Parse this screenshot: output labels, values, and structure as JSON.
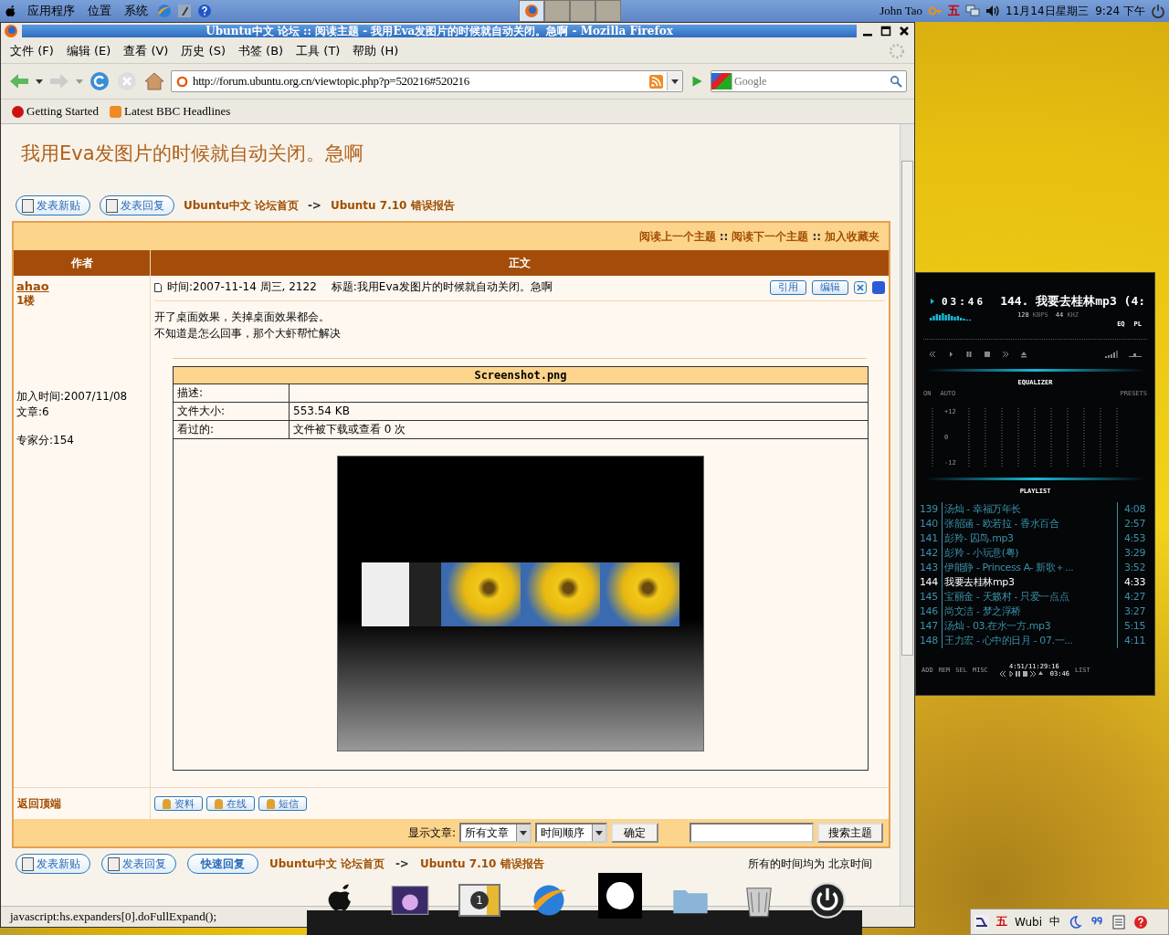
{
  "top_panel": {
    "menus": [
      "应用程序",
      "位置",
      "系统"
    ],
    "user": "John Tao",
    "ime": "五",
    "clock": "11月14日星期三  9:24 下午"
  },
  "firefox": {
    "title": "Ubuntu中文 论坛 :: 阅读主题 - 我用Eva发图片的时候就自动关闭。急啊 - Mozilla Firefox",
    "menu": [
      "文件 (F)",
      "编辑 (E)",
      "查看 (V)",
      "历史 (S)",
      "书签 (B)",
      "工具 (T)",
      "帮助 (H)"
    ],
    "url": "http://forum.ubuntu.org.cn/viewtopic.php?p=520216#520216",
    "search_placeholder": "Google",
    "bookmarks": [
      "Getting Started",
      "Latest BBC Headlines"
    ],
    "status": "javascript:hs.expanders[0].doFullExpand();"
  },
  "page": {
    "topic_title": "我用Eva发图片的时候就自动关闭。急啊",
    "top_buttons": [
      "发表新贴",
      "发表回复"
    ],
    "breadcrumb": [
      "Ubuntu中文 论坛首页",
      "->",
      "Ubuntu 7.10 错误报告"
    ],
    "nav_links": [
      "阅读上一个主题",
      "::",
      "阅读下一个主题",
      "::",
      "加入收藏夹"
    ],
    "columns": [
      "作者",
      "正文"
    ],
    "post": {
      "author": "ahao",
      "floor": "1楼",
      "joined": "加入时间:2007/11/08",
      "posts": "文章:6",
      "expert": "专家分:154",
      "time": "时间:2007-11-14 周三, 2122",
      "subject": "标题:我用Eva发图片的时候就自动关闭。急啊",
      "actions": [
        "引用",
        "编辑"
      ],
      "body": [
        "开了桌面效果，关掉桌面效果都会。",
        "不知道是怎么回事，那个大虾帮忙解决"
      ],
      "attachment": {
        "filename": "Screenshot.png",
        "rows": [
          {
            "label": "描述:"
          },
          {
            "label": "文件大小:",
            "value": "553.54 KB"
          },
          {
            "label": "看过的:",
            "value": "文件被下载或查看 0 次"
          }
        ]
      }
    },
    "back_to_top": "返回顶端",
    "profile_buttons": [
      "资料",
      "在线",
      "短信"
    ],
    "footer": {
      "show_label": "显示文章:",
      "select_posts": "所有文章",
      "select_order": "时间顺序",
      "ok": "确定",
      "search_button": "搜索主题"
    },
    "bottom_buttons": [
      "发表新贴",
      "发表回复",
      "快速回复"
    ],
    "bottom_breadcrumb": [
      "Ubuntu中文 论坛首页",
      "->",
      "Ubuntu 7.10 错误报告"
    ],
    "timezone": "所有的时间均为 北京时间"
  },
  "player": {
    "time": "03:46",
    "track": "144. 我要去桂林mp3 (4:",
    "kbps": "128",
    "kbps_unit": "KBPS",
    "khz": "44",
    "khz_unit": "KHZ",
    "toggles": [
      "EQ",
      "PL"
    ],
    "eq_title": "EQUALIZER",
    "eq_left": [
      "ON",
      "AUTO"
    ],
    "eq_presets": "PRESETS",
    "eq_scale": [
      "+12",
      "0",
      "-12"
    ],
    "playlist_title": "PLAYLIST",
    "playlist": [
      {
        "num": "139",
        "title": "汤灿 - 幸福万年长",
        "time": "4:08",
        "selected": false
      },
      {
        "num": "140",
        "title": "张韶涵 - 欧若拉 - 香水百合",
        "time": "2:57",
        "selected": false
      },
      {
        "num": "141",
        "title": "彭羚- 囚鸟.mp3",
        "time": "4:53",
        "selected": false
      },
      {
        "num": "142",
        "title": "彭羚 - 小玩意(粤)",
        "time": "3:29",
        "selected": false
      },
      {
        "num": "143",
        "title": "伊能静 - Princess A- 新歌＋...",
        "time": "3:52",
        "selected": false
      },
      {
        "num": "144",
        "title": "我要去桂林mp3",
        "time": "4:33",
        "selected": true
      },
      {
        "num": "145",
        "title": "宝丽金 - 天籁村 - 只爱一点点",
        "time": "4:27",
        "selected": false
      },
      {
        "num": "146",
        "title": "尚文洁 - 梦之浮桥",
        "time": "3:27",
        "selected": false
      },
      {
        "num": "147",
        "title": "汤灿 - 03.在水一方.mp3",
        "time": "5:15",
        "selected": false
      },
      {
        "num": "148",
        "title": "王力宏 - 心中的日月 - 07.一...",
        "time": "4:11",
        "selected": false
      }
    ],
    "bottom_buttons": [
      "ADD",
      "REM",
      "SEL",
      "MISC"
    ],
    "total": "4:51/11:29:16",
    "list": "LIST",
    "mini_time": "03:46"
  },
  "dock": {
    "badge": "1"
  },
  "tray": {
    "ime": "五",
    "wubi": "Wubi",
    "lang": "中"
  }
}
